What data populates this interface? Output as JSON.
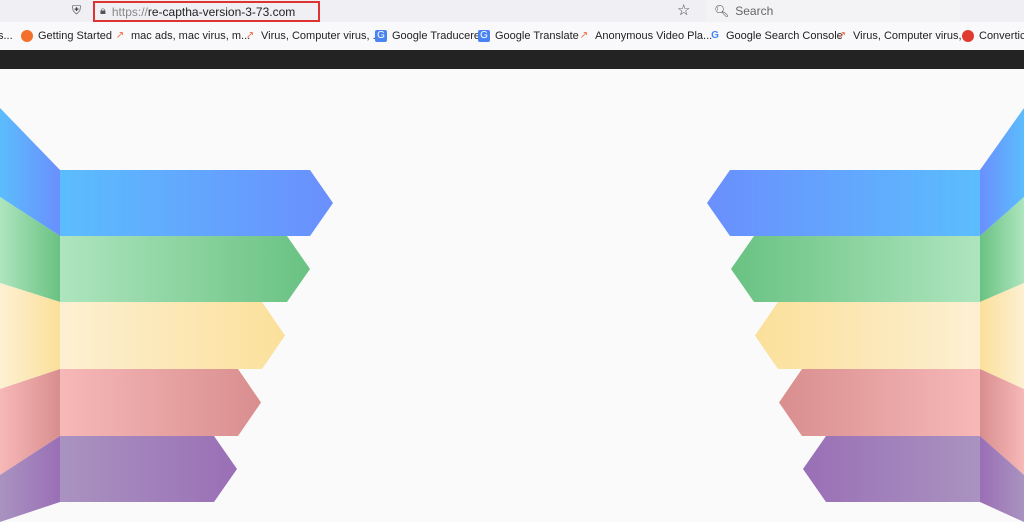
{
  "browser": {
    "url_scheme": "https://",
    "url_host": "re-captha-version-3-73.com",
    "search_placeholder": "Search",
    "icons": {
      "shield": "shield-icon",
      "lock": "lock-icon",
      "star": "bookmark-star-icon",
      "search": "search-icon"
    }
  },
  "bookmarks": [
    {
      "label": "s...",
      "icon": "none"
    },
    {
      "label": "Getting Started",
      "icon": "firefox-icon"
    },
    {
      "label": "mac ads, mac virus, m...",
      "icon": "trend-icon"
    },
    {
      "label": "Virus, Computer virus, ...",
      "icon": "trend-icon"
    },
    {
      "label": "Google Traducere",
      "icon": "google-translate-icon"
    },
    {
      "label": "Google Translate",
      "icon": "google-translate-icon"
    },
    {
      "label": "Anonymous Video Pla...",
      "icon": "trend-icon"
    },
    {
      "label": "Google Search Console",
      "icon": "google-icon"
    },
    {
      "label": "Virus, Computer virus, ...",
      "icon": "trend-icon"
    },
    {
      "label": "Convertic",
      "icon": "convert-icon"
    }
  ],
  "colors": {
    "blue": [
      "#5bbdfd",
      "#6a8ffd"
    ],
    "green": [
      "#aee5be",
      "#69c282"
    ],
    "yellow": [
      "#fdf0d3",
      "#fbe09a"
    ],
    "red": [
      "#f7b8b8",
      "#d98e8e"
    ],
    "purple": [
      "#a993c0",
      "#9a6fb6"
    ]
  }
}
